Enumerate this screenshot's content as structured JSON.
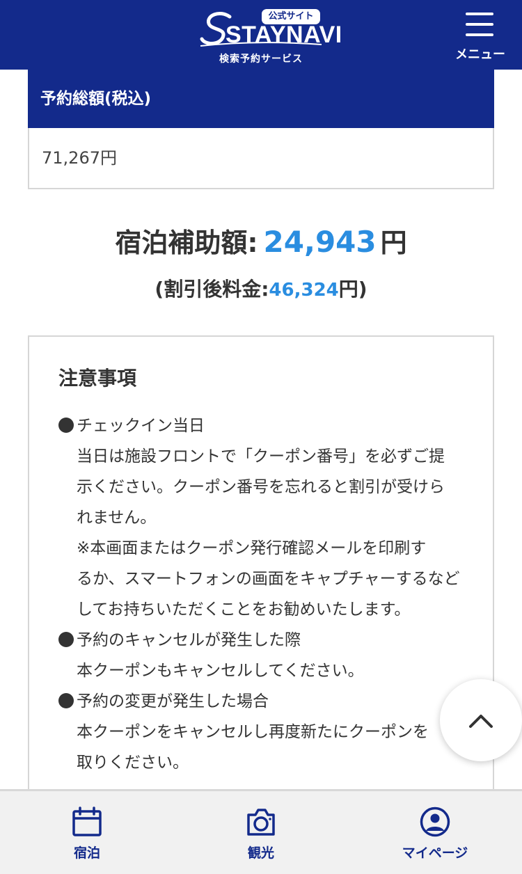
{
  "header": {
    "logo_badge": "公式サイト",
    "logo_text": "STAYNAVI",
    "logo_tagline": "検索予約サービス",
    "menu_label": "メニュー"
  },
  "total": {
    "heading": "予約総額(税込)",
    "value": "71,267円"
  },
  "subsidy": {
    "label": "宿泊補助額:",
    "amount": "24,943",
    "unit": "円",
    "after_prefix": "(割引後料金:",
    "after_amount": "46,324",
    "after_suffix": "円)"
  },
  "notes": {
    "title": "注意事項",
    "lines": [
      "チェックイン当日",
      "当日は施設フロントで「クーポン番号」を必ずご提",
      "示ください。クーポン番号を忘れると割引が受けら",
      "れません。",
      "※本画面またはクーポン発行確認メールを印刷す",
      "るか、スマートフォンの画面をキャプチャーするなど",
      "してお持ちいただくことをお勧めいたします。",
      "予約のキャンセルが発生した際",
      "本クーポンもキャンセルしてください。",
      "予約の変更が発生した場合",
      "本クーポンをキャンセルし再度新たにクーポンを",
      "取りください。"
    ]
  },
  "bottom_nav": {
    "items": [
      {
        "label": "宿泊",
        "icon": "calendar-icon"
      },
      {
        "label": "観光",
        "icon": "camera-icon"
      },
      {
        "label": "マイページ",
        "icon": "user-circle-icon"
      }
    ]
  },
  "colors": {
    "brand_navy": "#132a8b",
    "accent_blue": "#2a8de0",
    "text": "#333333"
  }
}
